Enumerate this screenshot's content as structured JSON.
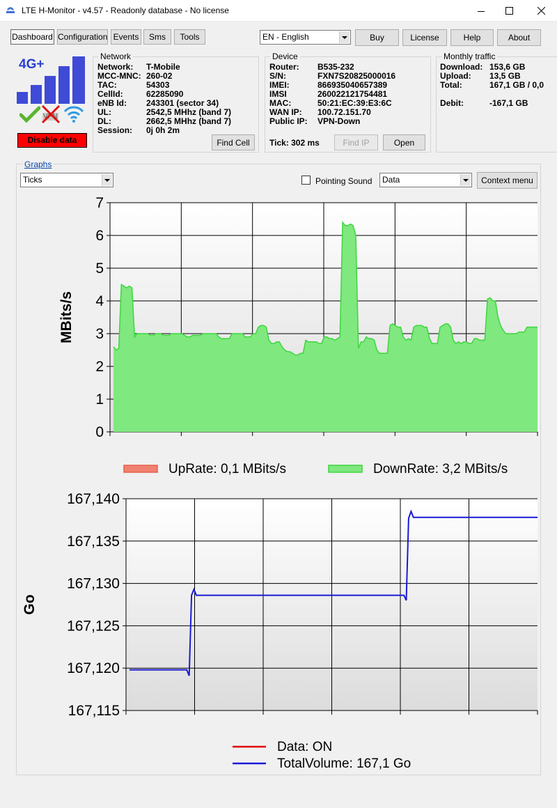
{
  "window": {
    "title": "LTE H-Monitor - v4.57 - Readonly database - No license"
  },
  "tabs": [
    {
      "label": "Dashboard"
    },
    {
      "label": "Configuration"
    },
    {
      "label": "Events"
    },
    {
      "label": "Sms"
    },
    {
      "label": "Tools"
    }
  ],
  "toolbar": {
    "language": "EN - English",
    "buy": "Buy",
    "license": "License",
    "help": "Help",
    "about": "About"
  },
  "signal": {
    "network_type": "4G+",
    "vpn_label": "VPN",
    "disable_button": "Disable data",
    "colors": {
      "bars": "#3f4bd6",
      "check": "#5ab52f",
      "cross": "#e01010",
      "wifi": "#2f9be0",
      "disable": "#ff0000"
    }
  },
  "network": {
    "title": "Network",
    "rows": [
      {
        "key": "Network:",
        "value": "T-Mobile"
      },
      {
        "key": "MCC-MNC:",
        "value": "260-02"
      },
      {
        "key": "TAC:",
        "value": "54303"
      },
      {
        "key": "CellId:",
        "value": "62285090"
      },
      {
        "key": "eNB Id:",
        "value": "243301 (sector 34)"
      },
      {
        "key": "UL:",
        "value": "2542,5 MHhz (band 7)"
      },
      {
        "key": "DL:",
        "value": "2662,5 MHhz (band 7)"
      },
      {
        "key": "Session:",
        "value": "0j 0h 2m"
      }
    ],
    "find_cell": "Find Cell"
  },
  "device": {
    "title": "Device",
    "rows": [
      {
        "key": "Router:",
        "value": "B535-232"
      },
      {
        "key": "S/N:",
        "value": "FXN7S20825000016"
      },
      {
        "key": "IMEI:",
        "value": "866935040657389"
      },
      {
        "key": "IMSI",
        "value": "260022121754481"
      },
      {
        "key": "MAC:",
        "value": "50:21:EC:39:E3:6C"
      },
      {
        "key": "WAN IP:",
        "value": "100.72.151.70"
      },
      {
        "key": "Public IP:",
        "value": "VPN-Down"
      }
    ],
    "tick": "Tick: 302 ms",
    "find_ip": "Find IP",
    "open": "Open"
  },
  "traffic": {
    "title": "Monthly traffic",
    "rows": [
      {
        "key": "Download:",
        "value": "153,6 GB"
      },
      {
        "key": "Upload:",
        "value": "13,5 GB"
      },
      {
        "key": "Total:",
        "value": "167,1 GB / 0,0"
      },
      {
        "key": "Debit:",
        "value": "-167,1 GB"
      }
    ]
  },
  "graphs": {
    "title": "Graphs",
    "ticks_select": "Ticks",
    "pointing_sound": "Pointing Sound",
    "pointing_sound_checked": false,
    "data_select": "Data",
    "context_menu": "Context menu"
  },
  "chart_data": [
    {
      "type": "area",
      "ylabel": "MBits/s",
      "ylim": [
        0,
        7
      ],
      "yticks": [
        "0",
        "1",
        "2",
        "3",
        "4",
        "5",
        "6",
        "7"
      ],
      "grid": true,
      "legend_placement": "bottom",
      "series": [
        {
          "name": "UpRate: 0,1 MBits/s",
          "color": "#e8604c",
          "values": [
            0.1,
            0.1,
            0.1,
            0.1,
            0.1,
            0.1,
            0.1,
            0.1,
            0.1,
            0.1,
            0.08,
            0.08,
            0.08,
            0.08,
            0.08,
            0.08,
            0.08,
            0.08,
            0.08,
            0.08,
            0.1,
            0.1,
            0.1,
            0.1,
            0.1,
            0.1,
            0.1,
            0.1,
            0.1,
            0.1,
            0.1,
            0.1,
            0.1,
            0.1,
            0.1,
            0.1,
            0.1,
            0.1,
            0.1,
            0.1,
            0.1,
            0.1,
            0.1,
            0.1,
            0.1,
            0.1,
            0.1,
            0.1,
            0.08,
            0.08,
            0.08,
            0.08,
            0.08,
            0.08,
            0.08,
            0.08,
            0.08,
            0.08,
            0.08,
            0.08,
            0.08,
            0.08,
            0.08,
            0.08,
            0.08,
            0.08,
            0.08,
            0.08,
            0.08,
            0.08,
            0.08,
            0.08,
            0.08,
            0.08,
            0.08,
            0.08,
            0.08,
            0.08,
            0.08,
            0.08,
            0.1,
            0.1,
            0.1,
            0.1,
            0.1,
            0.1,
            0.1,
            0.1,
            0.1,
            0.1,
            0.1,
            0.1,
            0.1,
            0.1,
            0.1,
            0.1,
            0.1,
            0.1,
            0.1,
            0.1,
            0.1,
            0.1,
            0.1,
            0.1,
            0.1,
            0.1,
            0.1,
            0.1,
            0.1,
            0.1,
            0.1,
            0.1,
            0.1,
            0.1,
            0.1,
            0.1,
            0.1,
            0.1,
            0.1,
            0.1,
            0.1,
            0.1,
            0.1,
            0.1,
            0.1,
            0.1,
            0.1,
            0.1,
            0.1,
            0.1,
            0.15,
            0.15,
            0.15,
            0.15,
            0.15,
            0.1,
            0.1,
            0.1,
            0.08,
            0.08,
            0.08,
            0.08,
            0.08,
            0.08,
            0.08,
            0.08,
            0.08,
            0.08,
            0.08,
            0.08,
            0.08,
            0.08,
            0.08,
            0.08,
            0.08,
            0.08,
            0.08,
            0.08,
            0.1,
            0.1,
            0.1,
            0.1,
            0.1,
            0.1,
            0.1,
            0.1,
            0.1,
            0.1,
            0.1,
            0.1,
            0.08,
            0.08,
            0.08,
            0.08,
            0.08,
            0.08,
            0.08,
            0.08,
            0.08,
            0.08,
            0.08,
            0.08,
            0.08,
            0.08,
            0.08,
            0.08,
            0.08,
            0.08,
            0.08,
            0.08,
            0.08,
            0.08,
            0.08,
            0.08,
            0.08,
            0.08,
            0.08,
            0.08,
            0.08,
            0.08,
            0.08,
            0.08,
            0.08,
            0.08,
            0.08,
            0.08,
            0.08,
            0.08,
            0.08,
            0.08,
            0.08,
            0.08,
            0.08,
            0.08,
            0.08,
            0.08,
            0.08,
            0.08,
            0.08,
            0.08,
            0.08,
            0.08,
            0.08,
            0.08,
            0.08,
            0.08,
            0.08,
            0.08,
            0.08,
            0.08,
            0.08,
            0.08,
            0.08,
            0.08,
            0.08,
            0.08,
            0.08,
            0.08,
            0.08,
            0.08
          ]
        },
        {
          "name": "DownRate: 3,2 MBits/s",
          "color": "#3dd63d",
          "values": [
            2.6,
            2.5,
            2.55,
            4.5,
            4.45,
            4.4,
            4.45,
            4.4,
            2.9,
            3.0,
            3.0,
            3.0,
            3.0,
            3.0,
            2.95,
            2.95,
            3.0,
            3.0,
            3.0,
            2.95,
            2.95,
            2.95,
            3.0,
            3.0,
            3.0,
            3.0,
            3.0,
            2.95,
            2.9,
            2.9,
            2.95,
            2.95,
            2.95,
            2.95,
            3.0,
            3.0,
            3.0,
            3.0,
            3.0,
            3.0,
            2.9,
            2.85,
            2.85,
            2.85,
            2.85,
            3.0,
            3.0,
            3.0,
            3.0,
            3.0,
            2.9,
            2.9,
            2.9,
            3.0,
            3.0,
            3.2,
            3.25,
            3.25,
            3.2,
            2.8,
            2.7,
            2.7,
            2.75,
            2.75,
            2.6,
            2.5,
            2.45,
            2.45,
            2.4,
            2.35,
            2.35,
            2.4,
            2.4,
            2.8,
            2.75,
            2.75,
            2.75,
            2.75,
            2.7,
            2.7,
            2.9,
            2.9,
            2.85,
            2.85,
            2.8,
            2.85,
            2.9,
            6.4,
            6.3,
            6.3,
            6.35,
            6.3,
            6.0,
            2.55,
            2.75,
            2.75,
            2.9,
            2.85,
            2.85,
            2.8,
            2.5,
            2.4,
            2.4,
            2.4,
            2.4,
            3.25,
            3.3,
            3.25,
            3.2,
            3.2,
            2.9,
            2.8,
            2.85,
            2.8,
            3.2,
            3.25,
            3.25,
            3.25,
            3.2,
            3.2,
            2.85,
            2.7,
            2.7,
            2.7,
            3.2,
            3.25,
            3.3,
            3.3,
            3.2,
            2.8,
            2.7,
            2.75,
            2.7,
            2.75,
            2.75,
            2.7,
            2.7,
            2.85,
            2.85,
            2.8,
            2.8,
            2.8,
            4.05,
            4.1,
            4.0,
            4.0,
            3.5,
            3.25,
            3.1,
            3.0,
            3.0,
            3.0,
            3.0,
            3.0,
            3.05,
            3.05,
            3.05,
            3.2,
            3.2,
            3.2,
            3.2,
            3.2
          ]
        }
      ]
    },
    {
      "type": "line",
      "ylabel": "Go",
      "ylim": [
        167.115,
        167.14
      ],
      "yticks": [
        "167,115",
        "167,120",
        "167,125",
        "167,130",
        "167,135",
        "167,140"
      ],
      "grid": true,
      "legend_placement": "bottom",
      "series": [
        {
          "name": "Data: ON",
          "color": "#e00000",
          "values": []
        },
        {
          "name": "TotalVolume: 167,1 Go",
          "color": "#1a1ad6",
          "values": [
            167.1198,
            167.1198,
            167.1198,
            167.1198,
            167.1198,
            167.1198,
            167.1198,
            167.1198,
            167.1198,
            167.1198,
            167.1198,
            167.1198,
            167.1198,
            167.1198,
            167.1198,
            167.1198,
            167.1198,
            167.1198,
            167.1198,
            167.1198,
            167.1198,
            167.1198,
            167.1198,
            167.1198,
            167.1198,
            167.1191,
            167.1286,
            167.1293,
            167.1286,
            167.1286,
            167.1286,
            167.1286,
            167.1286,
            167.1286,
            167.1286,
            167.1286,
            167.1286,
            167.1286,
            167.1286,
            167.1286,
            167.1286,
            167.1286,
            167.1286,
            167.1286,
            167.1286,
            167.1286,
            167.1286,
            167.1286,
            167.1286,
            167.1286,
            167.1286,
            167.1286,
            167.1286,
            167.1286,
            167.1286,
            167.1286,
            167.1286,
            167.1286,
            167.1286,
            167.1286,
            167.1286,
            167.1286,
            167.1286,
            167.1286,
            167.1286,
            167.1286,
            167.1286,
            167.1286,
            167.1286,
            167.1286,
            167.1286,
            167.1286,
            167.1286,
            167.1286,
            167.1286,
            167.1286,
            167.1286,
            167.1286,
            167.1286,
            167.1286,
            167.1286,
            167.1286,
            167.1286,
            167.1286,
            167.1286,
            167.1286,
            167.1286,
            167.1286,
            167.1286,
            167.1286,
            167.1286,
            167.1286,
            167.1286,
            167.1286,
            167.1286,
            167.1286,
            167.1286,
            167.1286,
            167.1286,
            167.1286,
            167.1286,
            167.1286,
            167.1286,
            167.1286,
            167.1286,
            167.1286,
            167.1286,
            167.1286,
            167.1286,
            167.1286,
            167.1286,
            167.1286,
            167.1286,
            167.1286,
            167.1286,
            167.1286,
            167.128,
            167.1377,
            167.1385,
            167.1378,
            167.1378,
            167.1378,
            167.1378,
            167.1378,
            167.1378,
            167.1378,
            167.1378,
            167.1378,
            167.1378,
            167.1378,
            167.1378,
            167.1378,
            167.1378,
            167.1378,
            167.1378,
            167.1378,
            167.1378,
            167.1378,
            167.1378,
            167.1378,
            167.1378,
            167.1378,
            167.1378,
            167.1378,
            167.1378,
            167.1378,
            167.1378,
            167.1378,
            167.1378,
            167.1378,
            167.1378,
            167.1378,
            167.1378,
            167.1378,
            167.1378,
            167.1378,
            167.1378,
            167.1378,
            167.1378,
            167.1378,
            167.1378,
            167.1378,
            167.1378,
            167.1378,
            167.1378,
            167.1378,
            167.1378,
            167.1378,
            167.1378,
            167.1378,
            167.1378,
            167.1378
          ]
        }
      ]
    }
  ]
}
